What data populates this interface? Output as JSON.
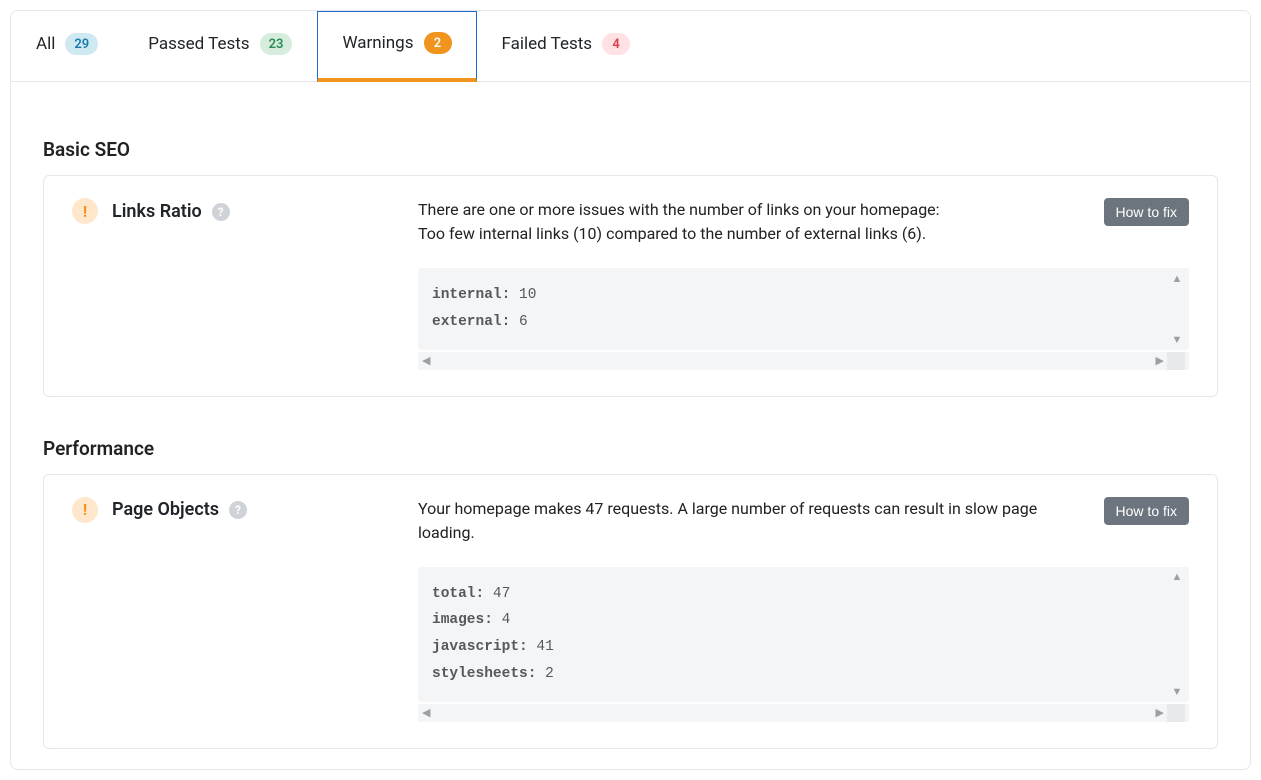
{
  "tabs": {
    "all": {
      "label": "All",
      "count": "29"
    },
    "passed": {
      "label": "Passed Tests",
      "count": "23"
    },
    "warnings": {
      "label": "Warnings",
      "count": "2"
    },
    "failed": {
      "label": "Failed Tests",
      "count": "4"
    }
  },
  "sections": {
    "basic_seo": {
      "title": "Basic SEO"
    },
    "performance": {
      "title": "Performance"
    }
  },
  "links_ratio": {
    "title": "Links Ratio",
    "desc_line1": "There are one or more issues with the number of links on your homepage:",
    "desc_line2": "Too few internal links (10) compared to the number of external links (6).",
    "fix_label": "How to fix",
    "code": {
      "internal_key": "internal:",
      "internal_val": " 10",
      "external_key": "external:",
      "external_val": " 6"
    }
  },
  "page_objects": {
    "title": "Page Objects",
    "desc": "Your homepage makes 47 requests. A large number of requests can result in slow page loading.",
    "fix_label": "How to fix",
    "code": {
      "total_key": "total:",
      "total_val": " 47",
      "images_key": "images:",
      "images_val": " 4",
      "js_key": "javascript:",
      "js_val": " 41",
      "css_key": "stylesheets:",
      "css_val": " 2"
    }
  }
}
